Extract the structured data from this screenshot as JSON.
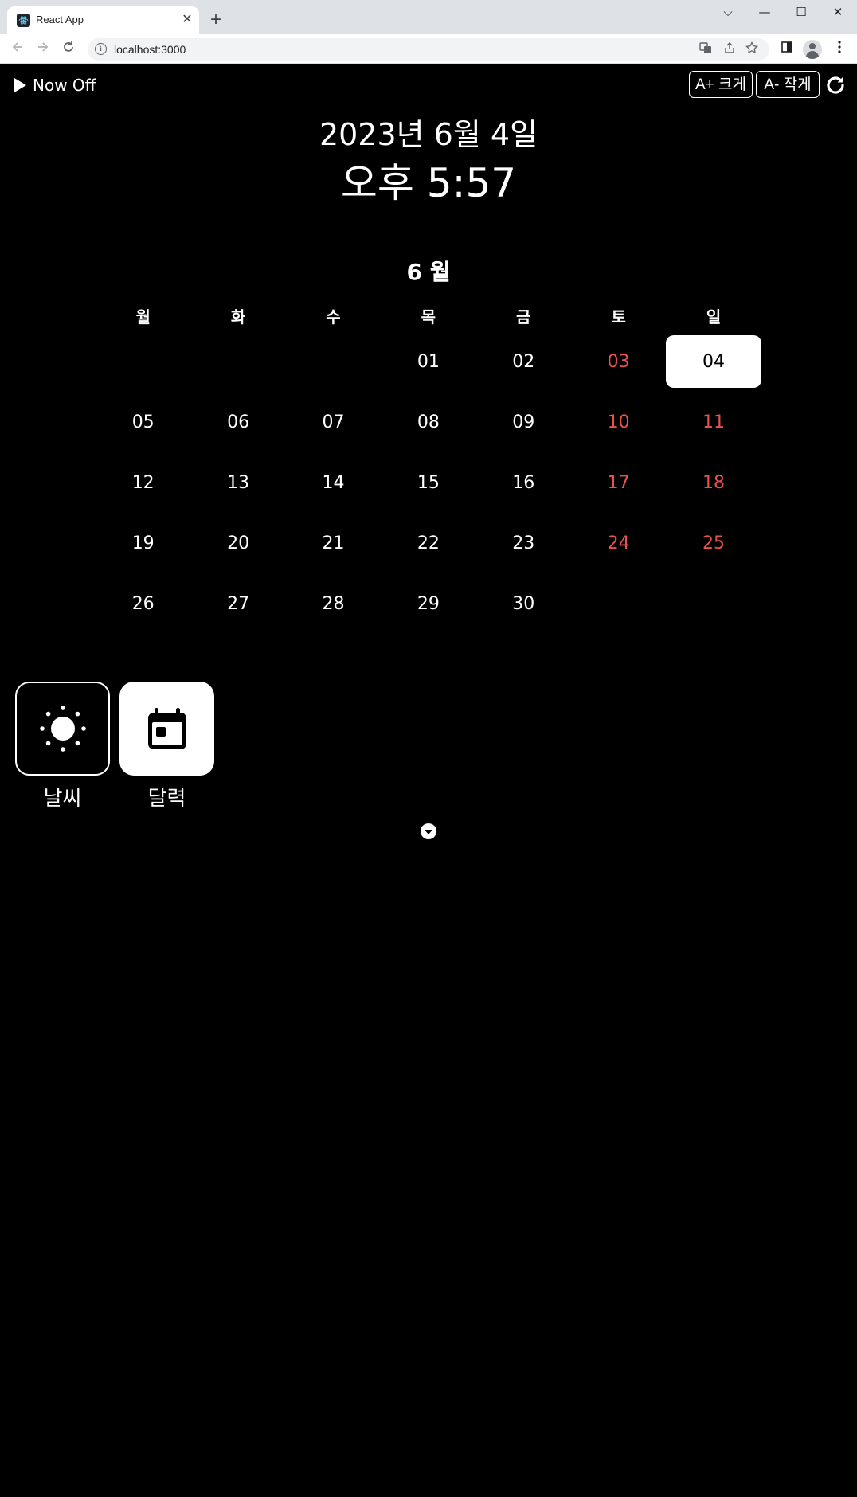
{
  "browser": {
    "tab_title": "React App",
    "tab_close": "✕",
    "new_tab": "+",
    "url": "localhost:3000",
    "window_controls": {
      "tab_search": "⌵",
      "minimize": "—",
      "maximize": "☐",
      "close": "✕"
    }
  },
  "header": {
    "now_toggle_label": "Now Off",
    "font_larger_label": "A+ 크게",
    "font_smaller_label": "A- 작게"
  },
  "clock": {
    "date": "2023년 6월 4일",
    "time": "오후 5:57"
  },
  "calendar": {
    "month_title": "6 월",
    "weekdays": [
      "월",
      "화",
      "수",
      "목",
      "금",
      "토",
      "일"
    ],
    "weeks": [
      [
        "",
        "",
        "",
        "01",
        "02",
        "03",
        "04"
      ],
      [
        "05",
        "06",
        "07",
        "08",
        "09",
        "10",
        "11"
      ],
      [
        "12",
        "13",
        "14",
        "15",
        "16",
        "17",
        "18"
      ],
      [
        "19",
        "20",
        "21",
        "22",
        "23",
        "24",
        "25"
      ],
      [
        "26",
        "27",
        "28",
        "29",
        "30",
        "",
        ""
      ]
    ],
    "today": "04",
    "weekend_color": "#e8524a"
  },
  "widgets": [
    {
      "label": "날씨",
      "icon": "sun-icon",
      "style": "outline"
    },
    {
      "label": "달력",
      "icon": "calendar-icon",
      "style": "filled"
    }
  ]
}
